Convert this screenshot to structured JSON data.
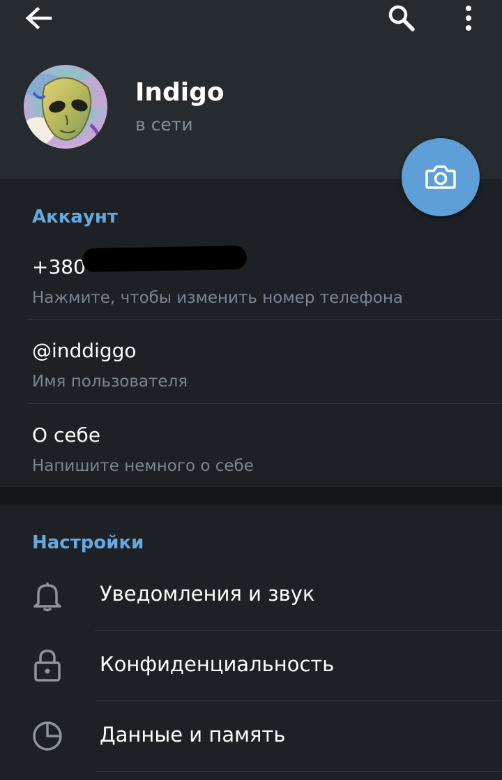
{
  "colors": {
    "accent": "#65a9e0",
    "fab": "#5e9fd8",
    "header_bg": "#262b30",
    "body_bg": "#1d2125"
  },
  "toolbar": {
    "back_icon": "arrow-left-icon",
    "search_icon": "search-icon",
    "menu_icon": "more-vertical-icon"
  },
  "profile": {
    "name": "Indigo",
    "status": "в сети",
    "avatar": "alien-avatar-image",
    "camera_icon": "camera-icon"
  },
  "account": {
    "title": "Аккаунт",
    "phone": {
      "value": "+380",
      "hint": "Нажмите, чтобы изменить номер телефона"
    },
    "username": {
      "value": "@inddiggo",
      "hint": "Имя пользователя"
    },
    "bio": {
      "value": "О себе",
      "hint": "Напишите немного о себе"
    }
  },
  "settings": {
    "title": "Настройки",
    "items": [
      {
        "label": "Уведомления и звук",
        "icon": "bell-icon"
      },
      {
        "label": "Конфиденциальность",
        "icon": "lock-icon"
      },
      {
        "label": "Данные и память",
        "icon": "pie-chart-icon"
      }
    ]
  }
}
